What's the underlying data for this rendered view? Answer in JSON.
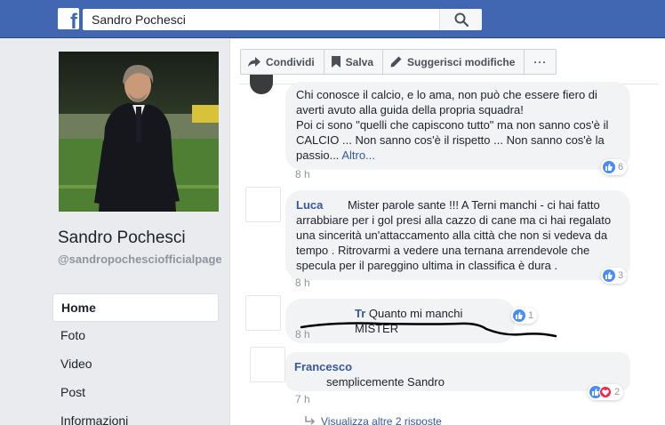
{
  "header": {
    "logo_letter": "f",
    "search_value": "Sandro Pochesci"
  },
  "page": {
    "name": "Sandro Pochesci",
    "handle": "@sandropochescio​fficialp​age"
  },
  "nav": {
    "items": [
      "Home",
      "Foto",
      "Video",
      "Post",
      "Informazioni"
    ]
  },
  "actions": {
    "share": "Condividi",
    "save": "Salva",
    "suggest": "Suggerisci modifiche",
    "more": "···"
  },
  "comments": [
    {
      "author": "",
      "text_lines": [
        "Chi conosce il calcio, e lo ama, non può che essere fiero di",
        "averti avuto alla guida della propria squadra!",
        "Poi ci sono \"quelli che capiscono tutto\" ma non sanno cos'è il",
        "CALCIO ... Non sanno cos'è il rispetto ... Non sanno cos'è la",
        "passio..."
      ],
      "see_more": "Altro...",
      "time": "8 h",
      "reactions": "6"
    },
    {
      "author": "Luca",
      "text": "Mister parole sante !!! A Terni manchi - ci hai fatto arrabbiare per i gol presi alla cazzo di cane ma ci hai regalato una sincerità un'attaccamento alla città che non si vedeva da tempo . Ritrovarmi a vedere una ternana arrendevole che specula per il pareggino ultima in classifica è dura .",
      "time": "8 h",
      "reactions": "3"
    },
    {
      "author": "Tr",
      "text": "Quanto mi manchi MISTER",
      "time": "8 h",
      "reactions": "1"
    },
    {
      "author": "Francesco",
      "text": "semplicemente Sandro",
      "time": "7 h",
      "reactions": "2"
    }
  ],
  "replies_link": "Visualizza altre 2 risposte",
  "colors": {
    "brand": "#4267b2",
    "link": "#385898",
    "like": "#4a8cf7",
    "love": "#f0284a"
  }
}
